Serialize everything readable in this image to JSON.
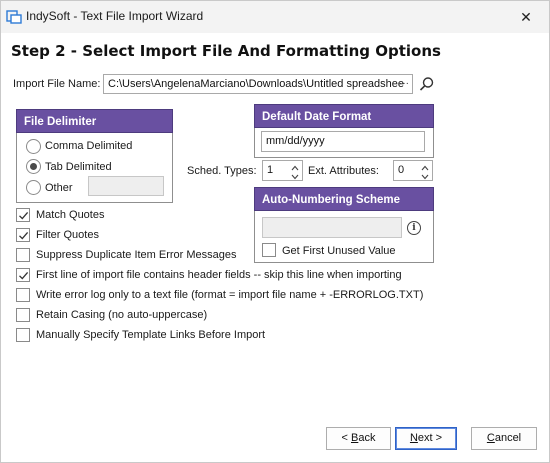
{
  "window": {
    "title": "IndySoft - Text File Import Wizard",
    "close_symbol": "✕"
  },
  "step_title": "Step 2 - Select Import File And Formatting Options",
  "import_file": {
    "label": "Import File Name:",
    "value": "C:\\Users\\AngelenaMarciano\\Downloads\\Untitled spreadshee",
    "ellipsis": "···"
  },
  "file_delimiter": {
    "title": "File Delimiter",
    "options": [
      {
        "label": "Comma Delimited",
        "checked": false
      },
      {
        "label": "Tab Delimited",
        "checked": true
      },
      {
        "label": "Other",
        "checked": false
      }
    ],
    "other_value": ""
  },
  "default_date_format": {
    "title": "Default Date Format",
    "value": "mm/dd/yyyy"
  },
  "sched_types": {
    "label": "Sched. Types:",
    "value": "1"
  },
  "ext_attributes": {
    "label": "Ext. Attributes:",
    "value": "0"
  },
  "auto_numbering": {
    "title": "Auto-Numbering Scheme",
    "scheme_value": "",
    "get_first_unused": {
      "label": "Get First Unused Value",
      "checked": false
    },
    "info_symbol": "i"
  },
  "options": [
    {
      "label": "Match Quotes",
      "checked": true
    },
    {
      "label": "Filter Quotes",
      "checked": true
    },
    {
      "label": "Suppress Duplicate Item Error Messages",
      "checked": false
    },
    {
      "label": "First line of import file contains header fields -- skip this line when importing",
      "checked": true
    },
    {
      "label": "Write error log only to a text file (format = import file name + -ERRORLOG.TXT)",
      "checked": false
    },
    {
      "label": "Retain Casing (no auto-uppercase)",
      "checked": false
    },
    {
      "label": "Manually Specify Template Links Before Import",
      "checked": false
    }
  ],
  "buttons": {
    "back": {
      "prefix": "< ",
      "underlined": "B",
      "rest": "ack"
    },
    "next": {
      "underlined": "N",
      "rest": "ext >"
    },
    "cancel": {
      "underlined": "C",
      "rest": "ancel"
    }
  },
  "colors": {
    "group_header": "#6950a1",
    "primary_button_border": "#2f62c6"
  }
}
